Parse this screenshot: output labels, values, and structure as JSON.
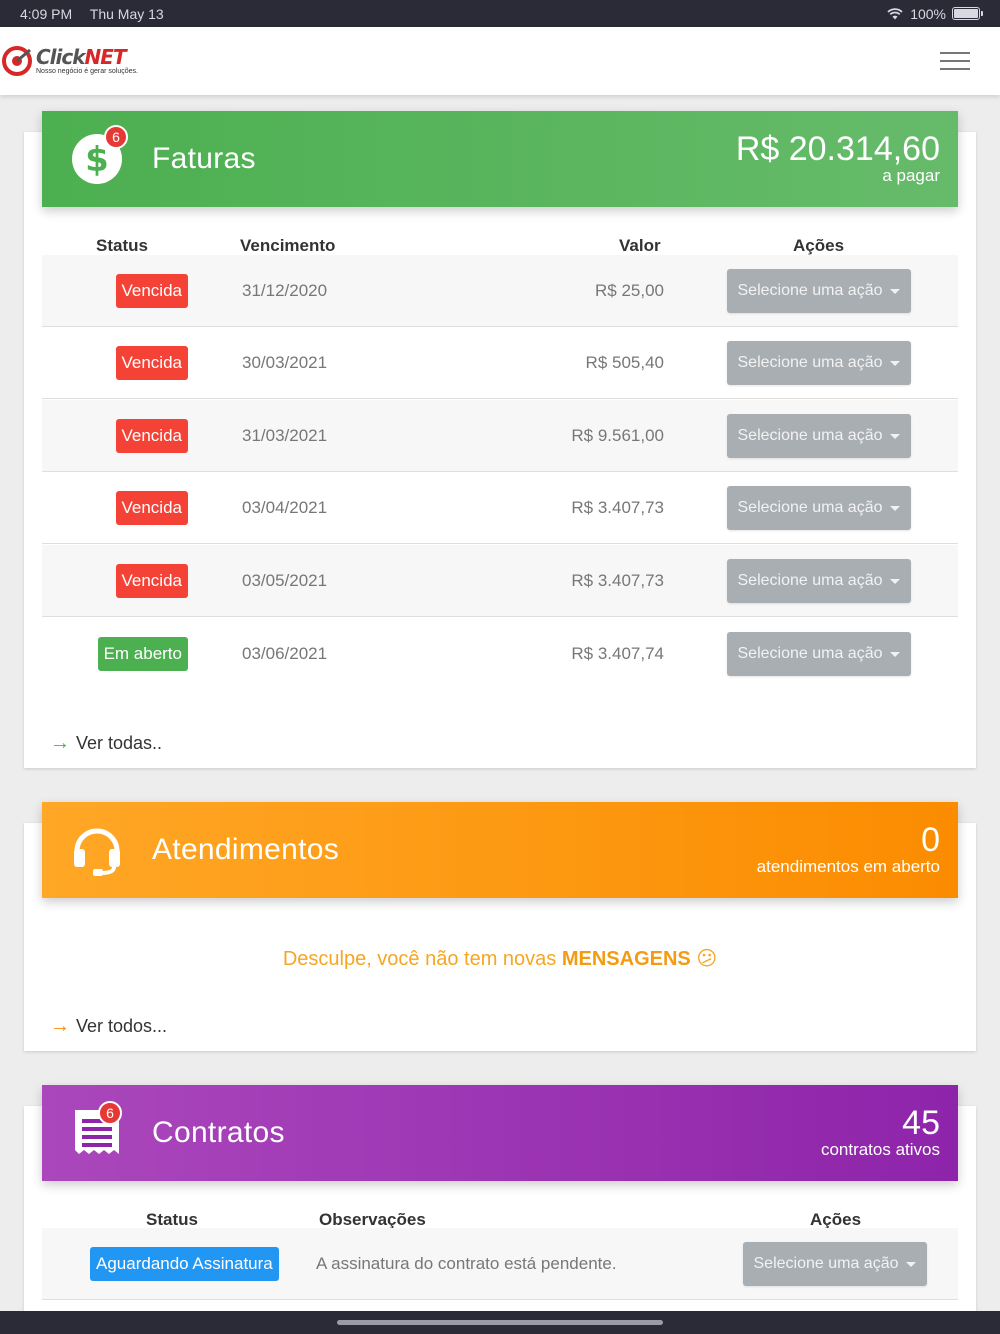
{
  "status_bar": {
    "time": "4:09 PM",
    "date": "Thu May 13",
    "battery": "100%"
  },
  "header": {
    "logo_name_a": "Click",
    "logo_name_b": "NET",
    "logo_tagline": "Nosso negócio é gerar soluções."
  },
  "faturas": {
    "title": "Faturas",
    "badge": "6",
    "total": "R$ 20.314,60",
    "total_sub": "a pagar",
    "columns": {
      "status": "Status",
      "vencimento": "Vencimento",
      "valor": "Valor",
      "acoes": "Ações"
    },
    "rows": [
      {
        "status": "Vencida",
        "vencimento": "31/12/2020",
        "valor": "R$ 25,00",
        "acao": "Selecione uma ação"
      },
      {
        "status": "Vencida",
        "vencimento": "30/03/2021",
        "valor": "R$ 505,40",
        "acao": "Selecione uma ação"
      },
      {
        "status": "Vencida",
        "vencimento": "31/03/2021",
        "valor": "R$ 9.561,00",
        "acao": "Selecione uma ação"
      },
      {
        "status": "Vencida",
        "vencimento": "03/04/2021",
        "valor": "R$ 3.407,73",
        "acao": "Selecione uma ação"
      },
      {
        "status": "Vencida",
        "vencimento": "03/05/2021",
        "valor": "R$ 3.407,73",
        "acao": "Selecione uma ação"
      },
      {
        "status": "Em aberto",
        "vencimento": "03/06/2021",
        "valor": "R$ 3.407,74",
        "acao": "Selecione uma ação"
      }
    ],
    "link": "Ver todas.."
  },
  "atendimentos": {
    "title": "Atendimentos",
    "count": "0",
    "count_sub": "atendimentos em aberto",
    "empty_a": "Desculpe, você não tem novas ",
    "empty_b": "MENSAGENS",
    "empty_emoji": "😕",
    "link": "Ver todos..."
  },
  "contratos": {
    "title": "Contratos",
    "badge": "6",
    "count": "45",
    "count_sub": "contratos ativos",
    "columns": {
      "status": "Status",
      "observacoes": "Observações",
      "acoes": "Ações"
    },
    "rows": [
      {
        "status": "Aguardando Assinatura",
        "observacao": "A assinatura do contrato está pendente.",
        "acao": "Selecione uma ação"
      }
    ]
  },
  "colors": {
    "green": "#4caf50",
    "orange": "#fb8c00",
    "purple": "#8e24aa",
    "red": "#f44336",
    "blue": "#2196f3"
  }
}
